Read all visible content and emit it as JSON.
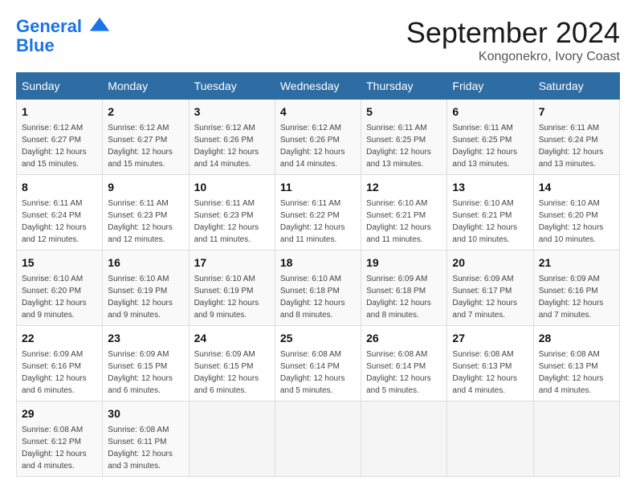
{
  "header": {
    "logo_line1": "General",
    "logo_line2": "Blue",
    "month_year": "September 2024",
    "location": "Kongonekro, Ivory Coast"
  },
  "weekdays": [
    "Sunday",
    "Monday",
    "Tuesday",
    "Wednesday",
    "Thursday",
    "Friday",
    "Saturday"
  ],
  "weeks": [
    [
      {
        "day": "1",
        "sunrise": "6:12 AM",
        "sunset": "6:27 PM",
        "daylight": "12 hours and 15 minutes."
      },
      {
        "day": "2",
        "sunrise": "6:12 AM",
        "sunset": "6:27 PM",
        "daylight": "12 hours and 15 minutes."
      },
      {
        "day": "3",
        "sunrise": "6:12 AM",
        "sunset": "6:26 PM",
        "daylight": "12 hours and 14 minutes."
      },
      {
        "day": "4",
        "sunrise": "6:12 AM",
        "sunset": "6:26 PM",
        "daylight": "12 hours and 14 minutes."
      },
      {
        "day": "5",
        "sunrise": "6:11 AM",
        "sunset": "6:25 PM",
        "daylight": "12 hours and 13 minutes."
      },
      {
        "day": "6",
        "sunrise": "6:11 AM",
        "sunset": "6:25 PM",
        "daylight": "12 hours and 13 minutes."
      },
      {
        "day": "7",
        "sunrise": "6:11 AM",
        "sunset": "6:24 PM",
        "daylight": "12 hours and 13 minutes."
      }
    ],
    [
      {
        "day": "8",
        "sunrise": "6:11 AM",
        "sunset": "6:24 PM",
        "daylight": "12 hours and 12 minutes."
      },
      {
        "day": "9",
        "sunrise": "6:11 AM",
        "sunset": "6:23 PM",
        "daylight": "12 hours and 12 minutes."
      },
      {
        "day": "10",
        "sunrise": "6:11 AM",
        "sunset": "6:23 PM",
        "daylight": "12 hours and 11 minutes."
      },
      {
        "day": "11",
        "sunrise": "6:11 AM",
        "sunset": "6:22 PM",
        "daylight": "12 hours and 11 minutes."
      },
      {
        "day": "12",
        "sunrise": "6:10 AM",
        "sunset": "6:21 PM",
        "daylight": "12 hours and 11 minutes."
      },
      {
        "day": "13",
        "sunrise": "6:10 AM",
        "sunset": "6:21 PM",
        "daylight": "12 hours and 10 minutes."
      },
      {
        "day": "14",
        "sunrise": "6:10 AM",
        "sunset": "6:20 PM",
        "daylight": "12 hours and 10 minutes."
      }
    ],
    [
      {
        "day": "15",
        "sunrise": "6:10 AM",
        "sunset": "6:20 PM",
        "daylight": "12 hours and 9 minutes."
      },
      {
        "day": "16",
        "sunrise": "6:10 AM",
        "sunset": "6:19 PM",
        "daylight": "12 hours and 9 minutes."
      },
      {
        "day": "17",
        "sunrise": "6:10 AM",
        "sunset": "6:19 PM",
        "daylight": "12 hours and 9 minutes."
      },
      {
        "day": "18",
        "sunrise": "6:10 AM",
        "sunset": "6:18 PM",
        "daylight": "12 hours and 8 minutes."
      },
      {
        "day": "19",
        "sunrise": "6:09 AM",
        "sunset": "6:18 PM",
        "daylight": "12 hours and 8 minutes."
      },
      {
        "day": "20",
        "sunrise": "6:09 AM",
        "sunset": "6:17 PM",
        "daylight": "12 hours and 7 minutes."
      },
      {
        "day": "21",
        "sunrise": "6:09 AM",
        "sunset": "6:16 PM",
        "daylight": "12 hours and 7 minutes."
      }
    ],
    [
      {
        "day": "22",
        "sunrise": "6:09 AM",
        "sunset": "6:16 PM",
        "daylight": "12 hours and 6 minutes."
      },
      {
        "day": "23",
        "sunrise": "6:09 AM",
        "sunset": "6:15 PM",
        "daylight": "12 hours and 6 minutes."
      },
      {
        "day": "24",
        "sunrise": "6:09 AM",
        "sunset": "6:15 PM",
        "daylight": "12 hours and 6 minutes."
      },
      {
        "day": "25",
        "sunrise": "6:08 AM",
        "sunset": "6:14 PM",
        "daylight": "12 hours and 5 minutes."
      },
      {
        "day": "26",
        "sunrise": "6:08 AM",
        "sunset": "6:14 PM",
        "daylight": "12 hours and 5 minutes."
      },
      {
        "day": "27",
        "sunrise": "6:08 AM",
        "sunset": "6:13 PM",
        "daylight": "12 hours and 4 minutes."
      },
      {
        "day": "28",
        "sunrise": "6:08 AM",
        "sunset": "6:13 PM",
        "daylight": "12 hours and 4 minutes."
      }
    ],
    [
      {
        "day": "29",
        "sunrise": "6:08 AM",
        "sunset": "6:12 PM",
        "daylight": "12 hours and 4 minutes."
      },
      {
        "day": "30",
        "sunrise": "6:08 AM",
        "sunset": "6:11 PM",
        "daylight": "12 hours and 3 minutes."
      },
      null,
      null,
      null,
      null,
      null
    ]
  ]
}
